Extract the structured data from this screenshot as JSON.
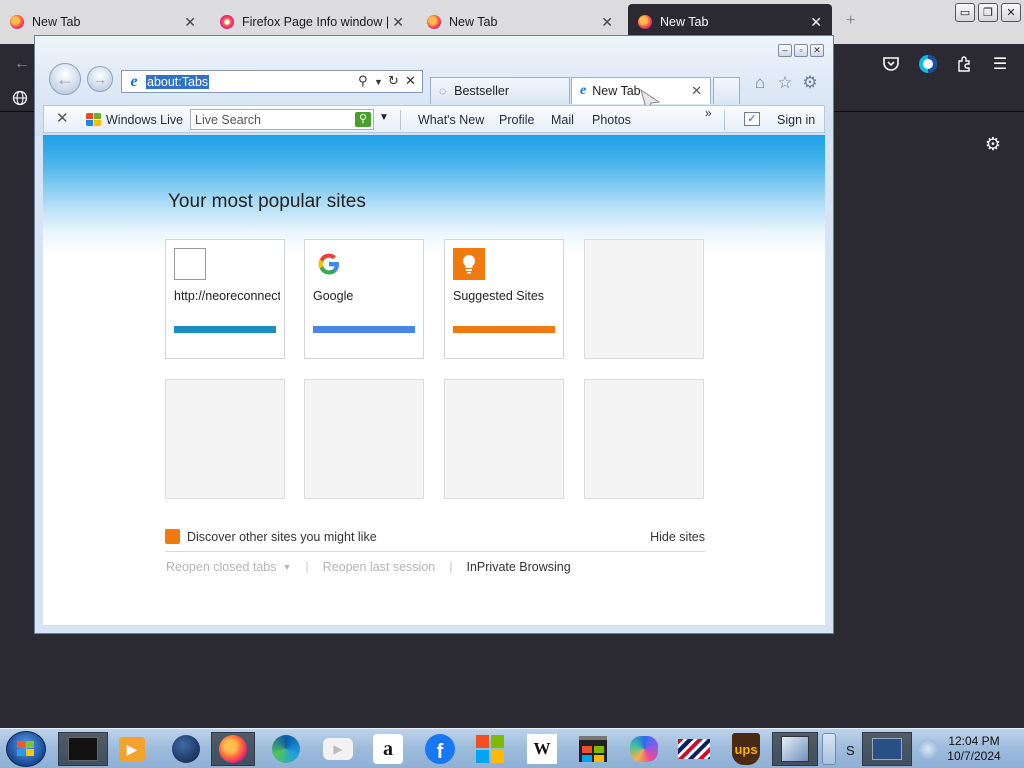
{
  "firefox": {
    "tabs": [
      {
        "title": "New Tab",
        "close": "✕"
      },
      {
        "title": "Firefox Page Info window | F",
        "close": "✕"
      },
      {
        "title": "New Tab",
        "close": "✕"
      },
      {
        "title": "New Tab",
        "close": "✕"
      }
    ],
    "window_buttons": [
      "▭",
      "❐",
      "✕"
    ],
    "new_tab_plus": "+"
  },
  "ie": {
    "address_url": "about:Tabs",
    "tabs": [
      {
        "title": "Bestseller"
      },
      {
        "title": "New Tab",
        "close": "✕"
      }
    ],
    "command_bar": {
      "windows_live": "Windows Live",
      "search_placeholder": "Live Search",
      "links": [
        "What's New",
        "Profile",
        "Mail",
        "Photos"
      ],
      "overflow": "»",
      "sign_in": "Sign in"
    },
    "page": {
      "heading": "Your most popular sites",
      "tiles": [
        {
          "label": "http://neoreconnect...",
          "bar_color": "#1a8fbf"
        },
        {
          "label": "Google",
          "bar_color": "#4a86e8"
        },
        {
          "label": "Suggested Sites",
          "bar_color": "#f07a0f"
        },
        {
          "label": ""
        },
        {
          "label": ""
        },
        {
          "label": ""
        },
        {
          "label": ""
        },
        {
          "label": ""
        }
      ],
      "discover_text": "Discover other sites you might like",
      "hide_sites": "Hide sites",
      "reopen_closed_tabs": "Reopen closed tabs",
      "reopen_last_session": "Reopen last session",
      "inprivate": "InPrivate Browsing"
    }
  },
  "taskbar": {
    "time": "12:04 PM",
    "date": "10/7/2024",
    "tray_letter": "S",
    "pinned": [
      "terminal",
      "media-player",
      "globe",
      "firefox",
      "edge",
      "youtube",
      "amazon",
      "facebook",
      "microsoft",
      "wikipedia",
      "store",
      "copilot",
      "bank-of-america",
      "ups",
      "paint"
    ]
  },
  "colors": {
    "ie_band": "#1da1e6",
    "firefox_dark": "#2b2a33",
    "accent_orange": "#f07a0f"
  }
}
